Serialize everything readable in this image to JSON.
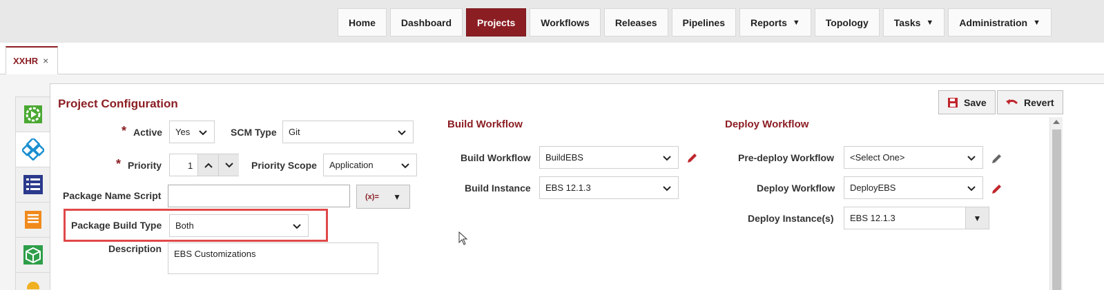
{
  "nav": {
    "items": [
      {
        "label": "Home",
        "dropdown": false,
        "active": false
      },
      {
        "label": "Dashboard",
        "dropdown": false,
        "active": false
      },
      {
        "label": "Projects",
        "dropdown": false,
        "active": true
      },
      {
        "label": "Workflows",
        "dropdown": false,
        "active": false
      },
      {
        "label": "Releases",
        "dropdown": false,
        "active": false
      },
      {
        "label": "Pipelines",
        "dropdown": false,
        "active": false
      },
      {
        "label": "Reports",
        "dropdown": true,
        "active": false
      },
      {
        "label": "Topology",
        "dropdown": false,
        "active": false
      },
      {
        "label": "Tasks",
        "dropdown": true,
        "active": false
      },
      {
        "label": "Administration",
        "dropdown": true,
        "active": false
      }
    ]
  },
  "tab": {
    "label": "XXHR",
    "close": "×"
  },
  "colors": {
    "accent": "#8b1e23",
    "highlight": "#e04848"
  },
  "sidebar": {
    "icons": [
      "play-gear-icon",
      "workflow-icon",
      "list-icon",
      "document-icon",
      "package-icon",
      "refresh-icon"
    ]
  },
  "config": {
    "title": "Project Configuration",
    "active": {
      "label": "Active",
      "value": "Yes"
    },
    "scm_type": {
      "label": "SCM Type",
      "value": "Git"
    },
    "priority": {
      "label": "Priority",
      "value": "1"
    },
    "priority_scope": {
      "label": "Priority Scope",
      "value": "Application"
    },
    "package_name_script": {
      "label": "Package Name Script",
      "value": "",
      "expr_button": "(x)="
    },
    "package_build_type": {
      "label": "Package Build Type",
      "value": "Both"
    },
    "description": {
      "label": "Description",
      "value": "EBS Customizations"
    }
  },
  "build": {
    "title": "Build Workflow",
    "workflow": {
      "label": "Build Workflow",
      "value": "BuildEBS"
    },
    "instance": {
      "label": "Build Instance",
      "value": "EBS 12.1.3"
    }
  },
  "deploy": {
    "title": "Deploy Workflow",
    "predeploy": {
      "label": "Pre-deploy Workflow",
      "value": "<Select One>"
    },
    "workflow": {
      "label": "Deploy Workflow",
      "value": "DeployEBS"
    },
    "instances": {
      "label": "Deploy Instance(s)",
      "value": "EBS 12.1.3"
    }
  },
  "actions": {
    "save": "Save",
    "revert": "Revert"
  }
}
